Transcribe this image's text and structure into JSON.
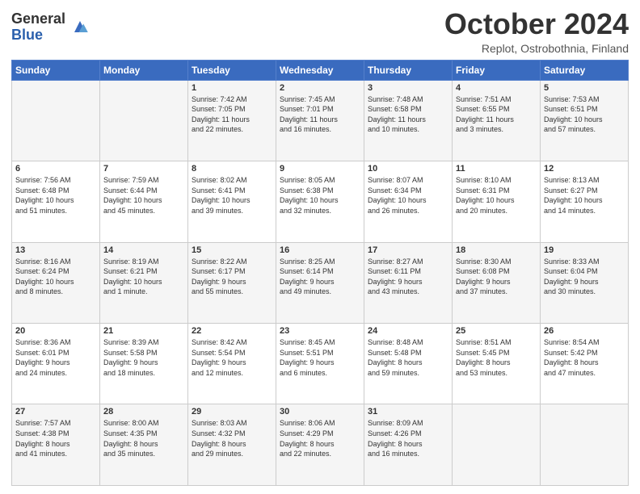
{
  "logo": {
    "general": "General",
    "blue": "Blue"
  },
  "header": {
    "month": "October 2024",
    "location": "Replot, Ostrobothnia, Finland"
  },
  "days_of_week": [
    "Sunday",
    "Monday",
    "Tuesday",
    "Wednesday",
    "Thursday",
    "Friday",
    "Saturday"
  ],
  "weeks": [
    [
      {
        "day": "",
        "info": ""
      },
      {
        "day": "",
        "info": ""
      },
      {
        "day": "1",
        "info": "Sunrise: 7:42 AM\nSunset: 7:05 PM\nDaylight: 11 hours\nand 22 minutes."
      },
      {
        "day": "2",
        "info": "Sunrise: 7:45 AM\nSunset: 7:01 PM\nDaylight: 11 hours\nand 16 minutes."
      },
      {
        "day": "3",
        "info": "Sunrise: 7:48 AM\nSunset: 6:58 PM\nDaylight: 11 hours\nand 10 minutes."
      },
      {
        "day": "4",
        "info": "Sunrise: 7:51 AM\nSunset: 6:55 PM\nDaylight: 11 hours\nand 3 minutes."
      },
      {
        "day": "5",
        "info": "Sunrise: 7:53 AM\nSunset: 6:51 PM\nDaylight: 10 hours\nand 57 minutes."
      }
    ],
    [
      {
        "day": "6",
        "info": "Sunrise: 7:56 AM\nSunset: 6:48 PM\nDaylight: 10 hours\nand 51 minutes."
      },
      {
        "day": "7",
        "info": "Sunrise: 7:59 AM\nSunset: 6:44 PM\nDaylight: 10 hours\nand 45 minutes."
      },
      {
        "day": "8",
        "info": "Sunrise: 8:02 AM\nSunset: 6:41 PM\nDaylight: 10 hours\nand 39 minutes."
      },
      {
        "day": "9",
        "info": "Sunrise: 8:05 AM\nSunset: 6:38 PM\nDaylight: 10 hours\nand 32 minutes."
      },
      {
        "day": "10",
        "info": "Sunrise: 8:07 AM\nSunset: 6:34 PM\nDaylight: 10 hours\nand 26 minutes."
      },
      {
        "day": "11",
        "info": "Sunrise: 8:10 AM\nSunset: 6:31 PM\nDaylight: 10 hours\nand 20 minutes."
      },
      {
        "day": "12",
        "info": "Sunrise: 8:13 AM\nSunset: 6:27 PM\nDaylight: 10 hours\nand 14 minutes."
      }
    ],
    [
      {
        "day": "13",
        "info": "Sunrise: 8:16 AM\nSunset: 6:24 PM\nDaylight: 10 hours\nand 8 minutes."
      },
      {
        "day": "14",
        "info": "Sunrise: 8:19 AM\nSunset: 6:21 PM\nDaylight: 10 hours\nand 1 minute."
      },
      {
        "day": "15",
        "info": "Sunrise: 8:22 AM\nSunset: 6:17 PM\nDaylight: 9 hours\nand 55 minutes."
      },
      {
        "day": "16",
        "info": "Sunrise: 8:25 AM\nSunset: 6:14 PM\nDaylight: 9 hours\nand 49 minutes."
      },
      {
        "day": "17",
        "info": "Sunrise: 8:27 AM\nSunset: 6:11 PM\nDaylight: 9 hours\nand 43 minutes."
      },
      {
        "day": "18",
        "info": "Sunrise: 8:30 AM\nSunset: 6:08 PM\nDaylight: 9 hours\nand 37 minutes."
      },
      {
        "day": "19",
        "info": "Sunrise: 8:33 AM\nSunset: 6:04 PM\nDaylight: 9 hours\nand 30 minutes."
      }
    ],
    [
      {
        "day": "20",
        "info": "Sunrise: 8:36 AM\nSunset: 6:01 PM\nDaylight: 9 hours\nand 24 minutes."
      },
      {
        "day": "21",
        "info": "Sunrise: 8:39 AM\nSunset: 5:58 PM\nDaylight: 9 hours\nand 18 minutes."
      },
      {
        "day": "22",
        "info": "Sunrise: 8:42 AM\nSunset: 5:54 PM\nDaylight: 9 hours\nand 12 minutes."
      },
      {
        "day": "23",
        "info": "Sunrise: 8:45 AM\nSunset: 5:51 PM\nDaylight: 9 hours\nand 6 minutes."
      },
      {
        "day": "24",
        "info": "Sunrise: 8:48 AM\nSunset: 5:48 PM\nDaylight: 8 hours\nand 59 minutes."
      },
      {
        "day": "25",
        "info": "Sunrise: 8:51 AM\nSunset: 5:45 PM\nDaylight: 8 hours\nand 53 minutes."
      },
      {
        "day": "26",
        "info": "Sunrise: 8:54 AM\nSunset: 5:42 PM\nDaylight: 8 hours\nand 47 minutes."
      }
    ],
    [
      {
        "day": "27",
        "info": "Sunrise: 7:57 AM\nSunset: 4:38 PM\nDaylight: 8 hours\nand 41 minutes."
      },
      {
        "day": "28",
        "info": "Sunrise: 8:00 AM\nSunset: 4:35 PM\nDaylight: 8 hours\nand 35 minutes."
      },
      {
        "day": "29",
        "info": "Sunrise: 8:03 AM\nSunset: 4:32 PM\nDaylight: 8 hours\nand 29 minutes."
      },
      {
        "day": "30",
        "info": "Sunrise: 8:06 AM\nSunset: 4:29 PM\nDaylight: 8 hours\nand 22 minutes."
      },
      {
        "day": "31",
        "info": "Sunrise: 8:09 AM\nSunset: 4:26 PM\nDaylight: 8 hours\nand 16 minutes."
      },
      {
        "day": "",
        "info": ""
      },
      {
        "day": "",
        "info": ""
      }
    ]
  ]
}
